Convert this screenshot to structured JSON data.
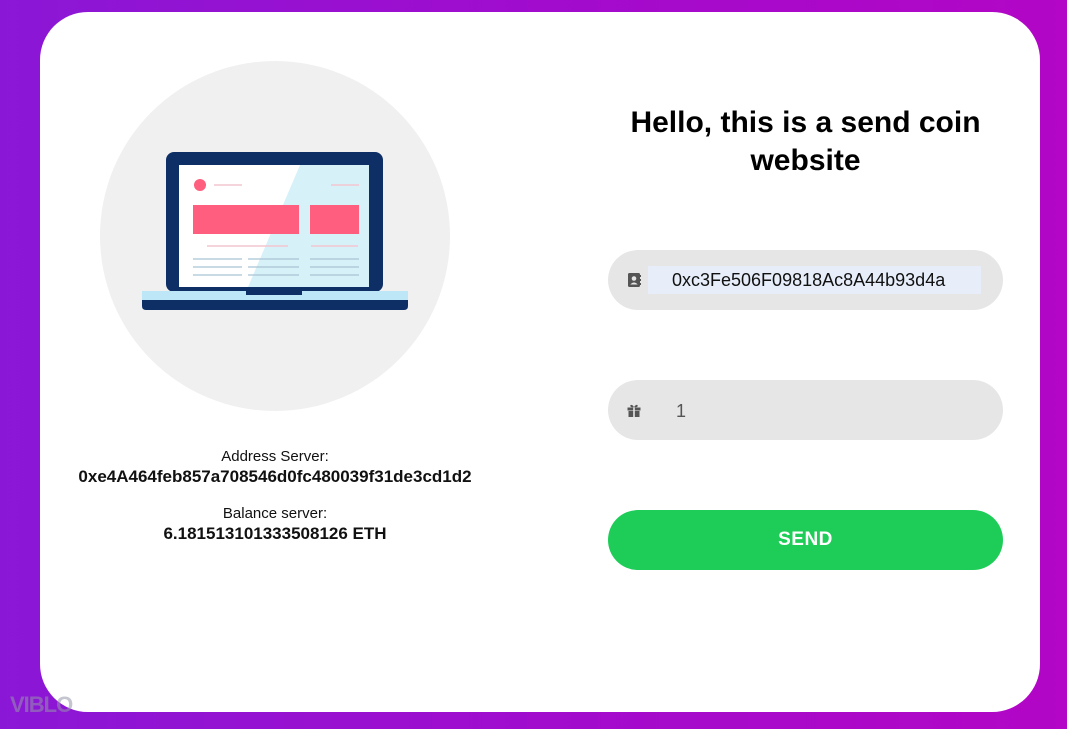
{
  "server": {
    "address_label": "Address Server:",
    "address_value": "0xe4A464feb857a708546d0fc480039f31de3cd1d2",
    "balance_label": "Balance server:",
    "balance_value": "6.181513101333508126 ETH"
  },
  "form": {
    "title": "Hello, this is a send coin website",
    "address_input": {
      "value": "0xc3Fe506F09818Ac8A44b93d4a",
      "icon": "address-book-icon"
    },
    "amount_input": {
      "value": "1",
      "icon": "gift-icon"
    },
    "send_label": "SEND"
  },
  "illustration": {
    "icon": "laptop-icon"
  },
  "watermark": "VIBLO",
  "colors": {
    "background_left": "#8b17d6",
    "background_right": "#b306c6",
    "card": "#ffffff",
    "input_bg": "#e6e6e6",
    "send_button": "#1ecd58",
    "laptop_frame": "#0d2f66",
    "banner": "#ff5e7e"
  }
}
